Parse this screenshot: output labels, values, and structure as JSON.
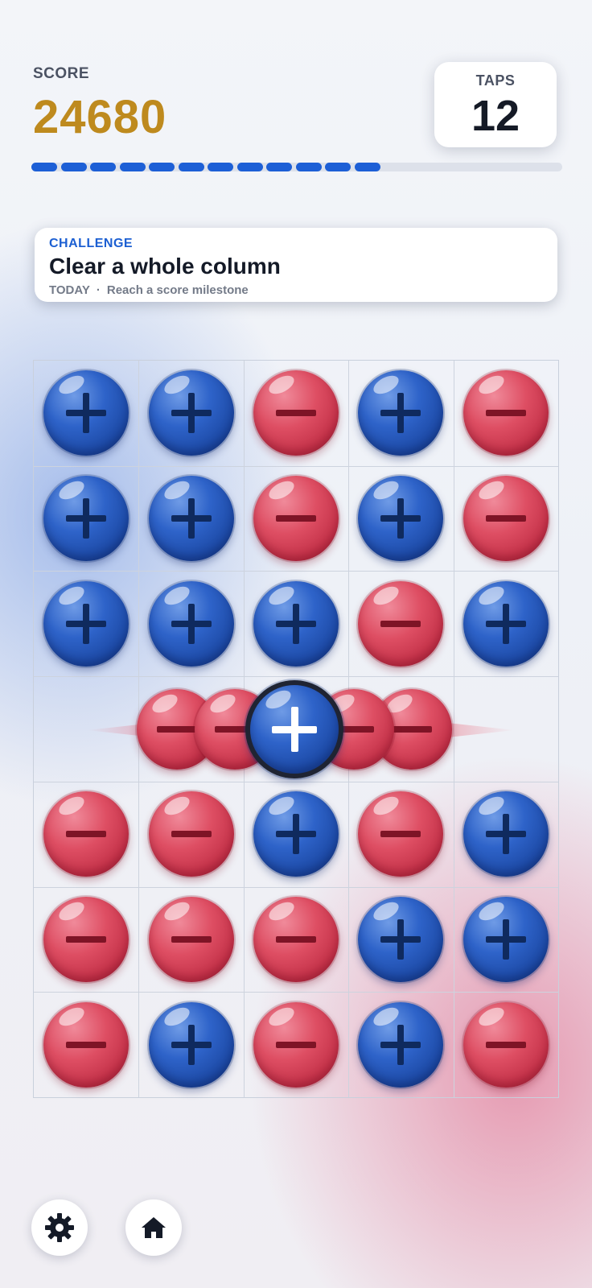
{
  "header": {
    "score_label": "SCORE",
    "score_value": "24680",
    "taps_label": "TAPS",
    "taps_value": "12",
    "progress": {
      "filled_segments": 12,
      "total_segments": 18
    }
  },
  "challenge": {
    "tag": "CHALLENGE",
    "title": "Clear a whole column",
    "period": "TODAY",
    "separator": "·",
    "subtitle": "Reach a score milestone"
  },
  "board": {
    "columns": 5,
    "rows": 7,
    "cells": [
      [
        "plus",
        "plus",
        "minus",
        "plus",
        "minus"
      ],
      [
        "plus",
        "plus",
        "minus",
        "plus",
        "minus"
      ],
      [
        "plus",
        "plus",
        "plus",
        "minus",
        "plus"
      ],
      [
        "empty",
        "minus",
        "plus",
        "minus",
        "empty"
      ],
      [
        "minus",
        "minus",
        "plus",
        "minus",
        "plus"
      ],
      [
        "minus",
        "minus",
        "minus",
        "plus",
        "plus"
      ],
      [
        "minus",
        "plus",
        "minus",
        "plus",
        "minus"
      ]
    ],
    "selected": {
      "row": 3,
      "col": 2
    },
    "animating_row": {
      "row": 3,
      "balls": [
        "minus",
        "minus",
        "plus",
        "minus",
        "minus"
      ]
    }
  },
  "controls": {
    "settings_icon": "gear-icon",
    "home_icon": "home-icon"
  },
  "colors": {
    "plus_ball": "#2e63c9",
    "minus_ball": "#de4e63",
    "score": "#be8a1e",
    "accent": "#1d5fd6",
    "text_dark": "#151a26"
  }
}
